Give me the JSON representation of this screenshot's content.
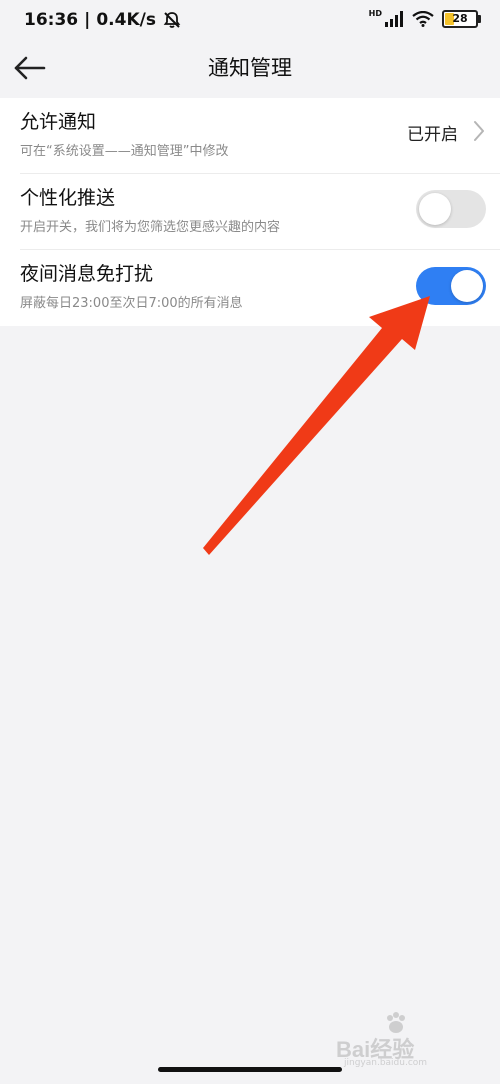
{
  "status_bar": {
    "time": "16:36",
    "separator": "|",
    "speed": "0.4K/s",
    "network_label": "HD",
    "battery_level": "28"
  },
  "header": {
    "title": "通知管理"
  },
  "settings": [
    {
      "title": "允许通知",
      "subtitle": "可在“系统设置——通知管理”中修改",
      "value": "已开启"
    },
    {
      "title": "个性化推送",
      "subtitle": "开启开关，我们将为您筛选您更感兴趣的内容",
      "enabled": false
    },
    {
      "title": "夜间消息免打扰",
      "subtitle": "屏蔽每日23:00至次日7:00的所有消息",
      "enabled": true
    }
  ],
  "colors": {
    "toggle_on": "#2f7ff3",
    "toggle_off": "#e4e4e4",
    "annotation_arrow": "#f03a17"
  },
  "watermark": {
    "text": "Bai经验",
    "subtext": "jingyan.baidu.com"
  }
}
